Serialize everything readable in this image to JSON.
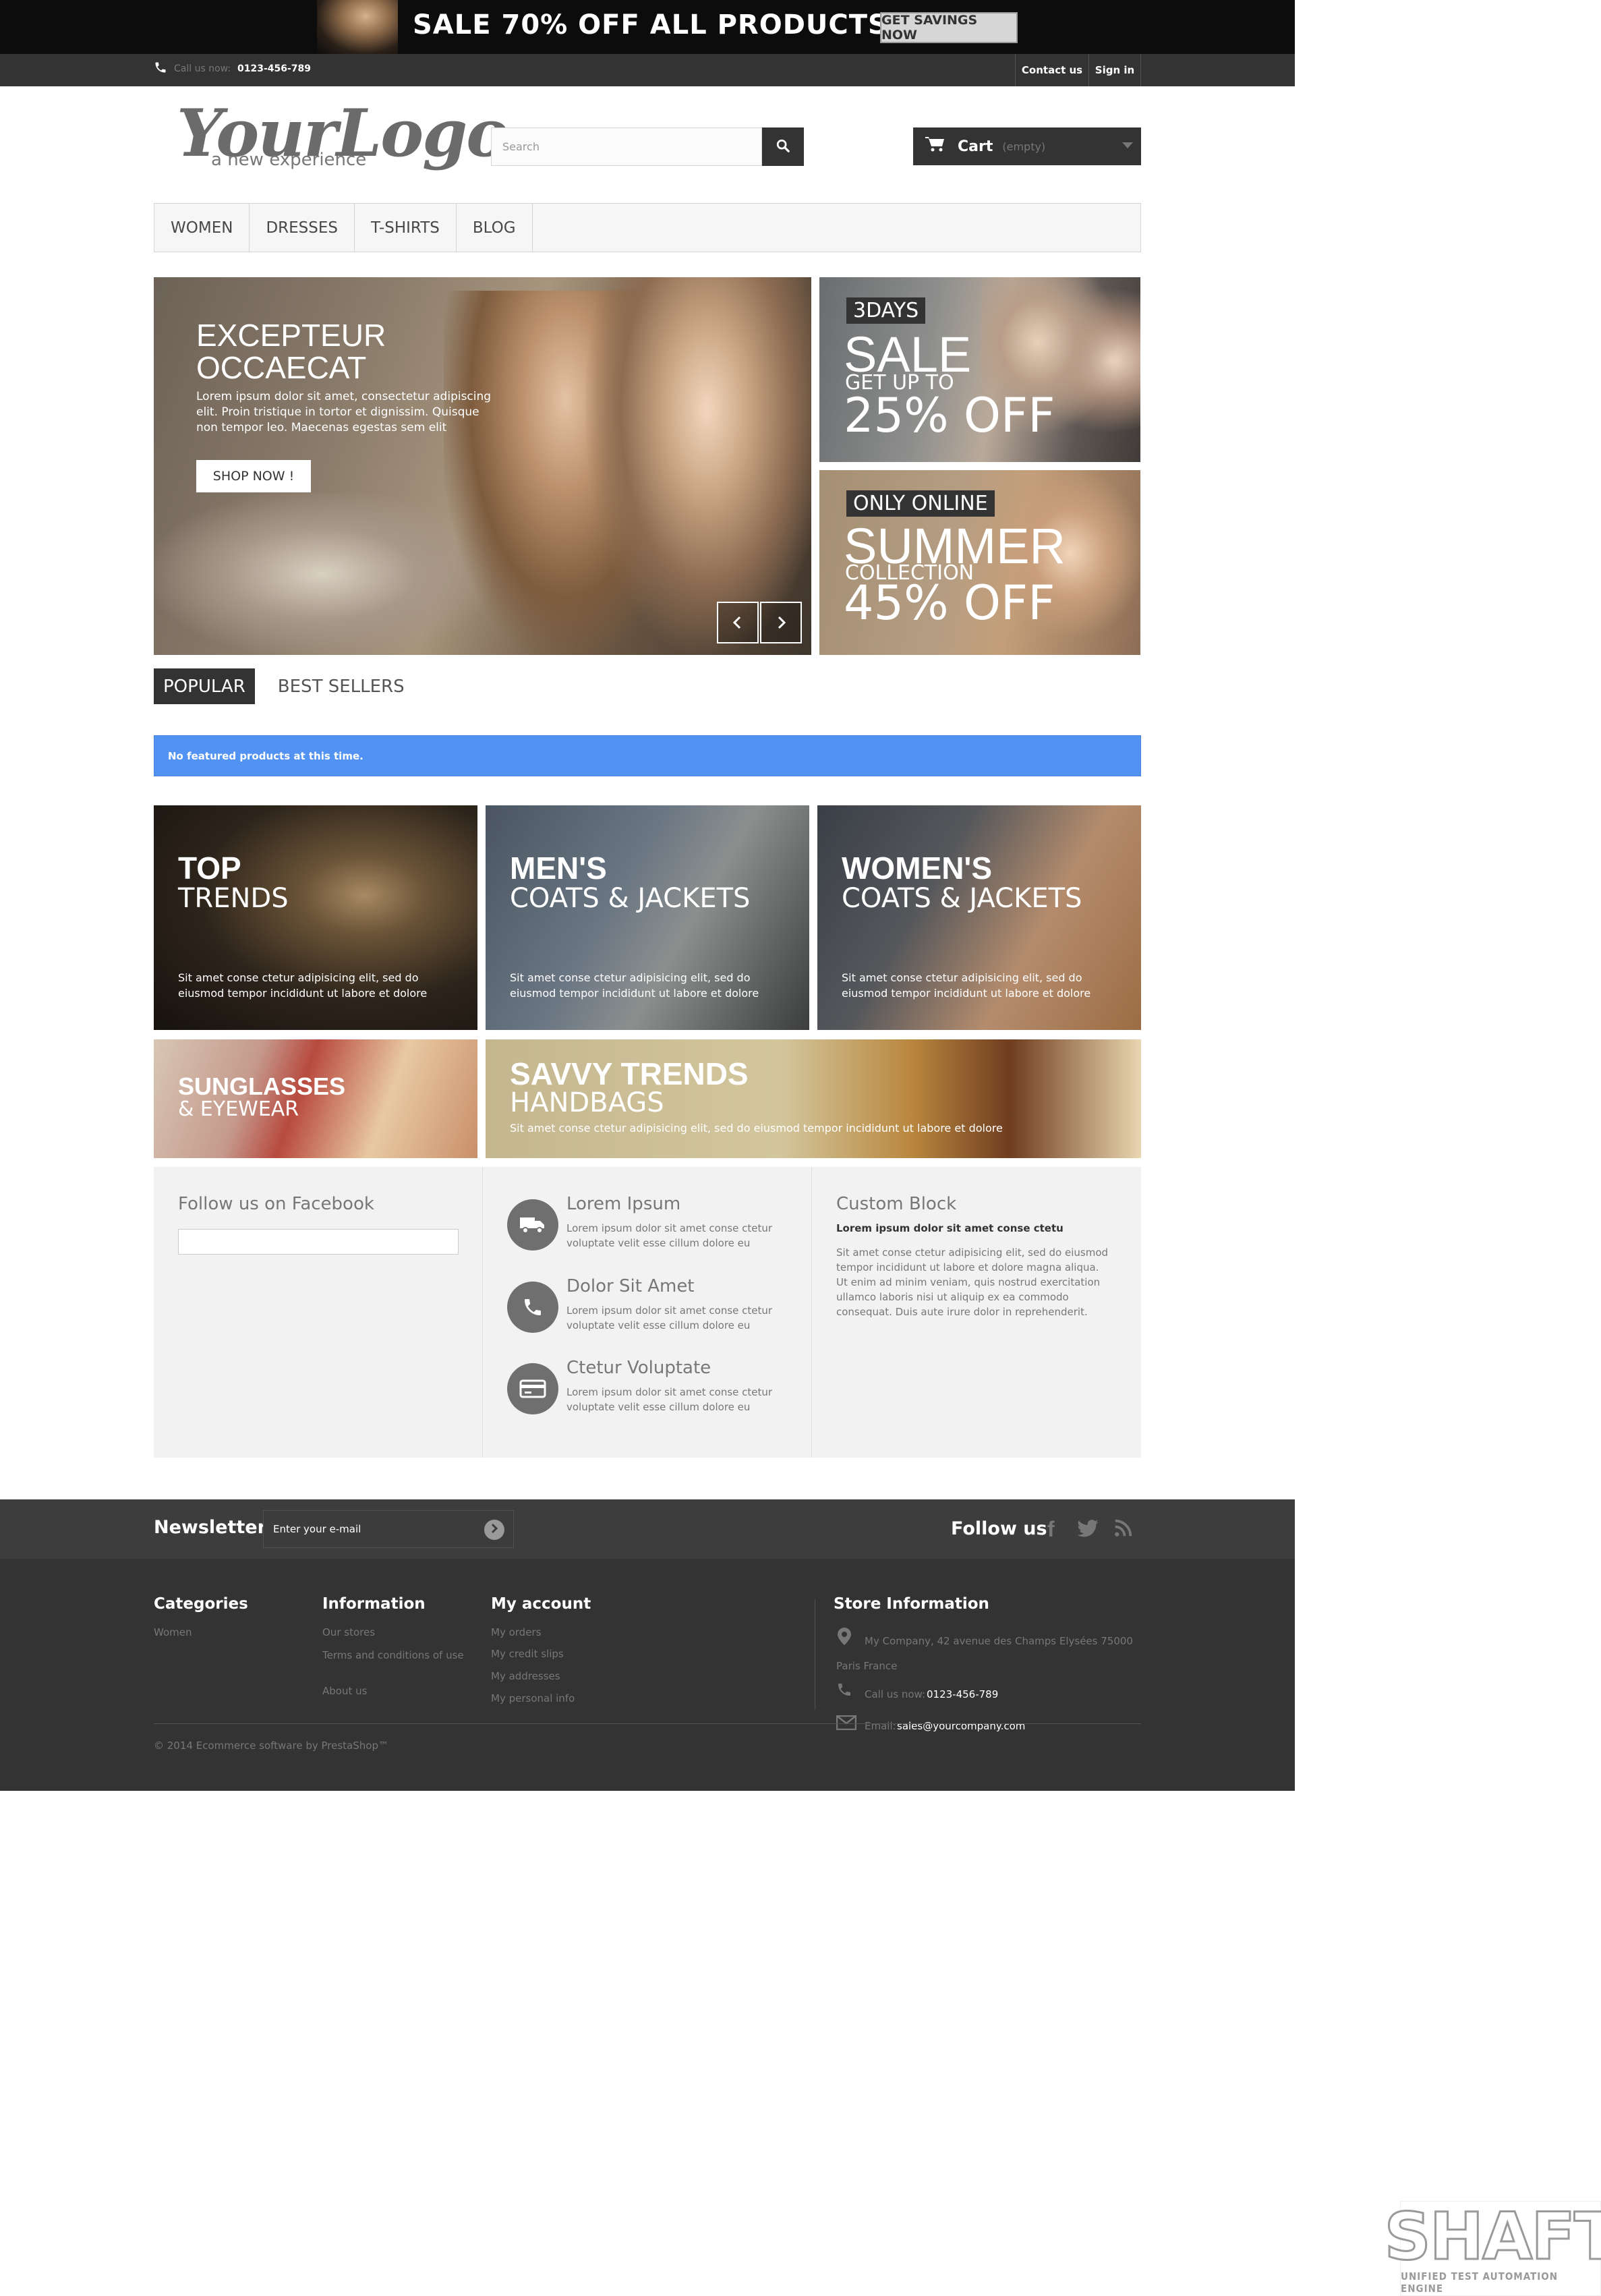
{
  "banner": {
    "sale_text": "SALE 70% OFF ALL PRODUCTS",
    "button": "GET SAVINGS NOW"
  },
  "topnav": {
    "call_label": "Call us now:",
    "phone": "0123-456-789",
    "contact": "Contact us",
    "signin": "Sign in"
  },
  "header": {
    "logo_main": "YourLogo",
    "logo_sub": "a new experience",
    "search_placeholder": "Search",
    "cart_label": "Cart",
    "cart_status": "(empty)"
  },
  "menu": [
    "WOMEN",
    "DRESSES",
    "T-SHIRTS",
    "BLOG"
  ],
  "slider": {
    "title_line1": "EXCEPTEUR",
    "title_line2": "OCCAECAT",
    "desc": "Lorem ipsum dolor sit amet, consectetur adipiscing elit. Proin tristique in tortor et dignissim. Quisque non tempor leo. Maecenas egestas sem elit",
    "button": "SHOP NOW !"
  },
  "side_banners": [
    {
      "tag": "3DAYS",
      "big": "SALE",
      "mid": "GET UP TO",
      "pct": "25% OFF"
    },
    {
      "tag": "ONLY ONLINE",
      "big": "SUMMER",
      "mid": "COLLECTION",
      "pct": "45% OFF"
    }
  ],
  "tabs": [
    "POPULAR",
    "BEST SELLERS"
  ],
  "alert": "No featured products at this time.",
  "tiles": [
    {
      "h1": "TOP",
      "h2": "TRENDS",
      "txt": "Sit amet conse ctetur adipisicing elit, sed do eiusmod tempor incididunt ut labore et dolore"
    },
    {
      "h1": "MEN'S",
      "h2": "COATS & JACKETS",
      "txt": "Sit amet conse ctetur adipisicing elit, sed do eiusmod tempor incididunt ut labore et dolore"
    },
    {
      "h1": "WOMEN'S",
      "h2": "COATS & JACKETS",
      "txt": "Sit amet conse ctetur adipisicing elit, sed do eiusmod tempor incididunt ut labore et dolore"
    },
    {
      "h1": "SUNGLASSES",
      "h2": "& EYEWEAR",
      "txt": ""
    },
    {
      "h1": "SAVVY TRENDS",
      "h2": "HANDBAGS",
      "txt": "Sit amet conse ctetur adipisicing elit, sed do eiusmod tempor incididunt ut labore et dolore"
    }
  ],
  "info": {
    "facebook_title": "Follow us on Facebook",
    "items": [
      {
        "icon": "truck-icon",
        "title": "Lorem Ipsum",
        "text": "Lorem ipsum dolor sit amet conse ctetur voluptate velit esse cillum dolore eu"
      },
      {
        "icon": "phone-icon",
        "title": "Dolor Sit Amet",
        "text": "Lorem ipsum dolor sit amet conse ctetur voluptate velit esse cillum dolore eu"
      },
      {
        "icon": "credit-card-icon",
        "title": "Ctetur Voluptate",
        "text": "Lorem ipsum dolor sit amet conse ctetur voluptate velit esse cillum dolore eu"
      }
    ],
    "custom_title": "Custom Block",
    "custom_subtitle": "Lorem ipsum dolor sit amet conse ctetu",
    "custom_text": "Sit amet conse ctetur adipisicing elit, sed do eiusmod tempor incididunt ut labore et dolore magna aliqua. Ut enim ad minim veniam, quis nostrud exercitation ullamco laboris nisi ut aliquip ex ea commodo consequat. Duis aute irure dolor in reprehenderit."
  },
  "newsletter": {
    "title": "Newsletter",
    "placeholder": "Enter your e-mail",
    "follow": "Follow us"
  },
  "footer": {
    "categories_title": "Categories",
    "categories": [
      "Women"
    ],
    "information_title": "Information",
    "information": [
      "Our stores",
      "Terms and conditions of use",
      "About us"
    ],
    "account_title": "My account",
    "account": [
      "My orders",
      "My credit slips",
      "My addresses",
      "My personal info"
    ],
    "store_title": "Store Information",
    "address": "My Company, 42 avenue des Champs Elysées 75000 Paris France",
    "call_label": "Call us now:",
    "phone": "0123-456-789",
    "email_label": "Email:",
    "email": "sales@yourcompany.com",
    "copyright": "© 2014 Ecommerce software by PrestaShop™"
  },
  "watermark": {
    "title": "SHAFT",
    "subtitle": "UNIFIED TEST AUTOMATION ENGINE"
  },
  "colors": {
    "dark": "#333333",
    "alert_blue": "#5192f3",
    "panel": "#f2f2f2"
  }
}
